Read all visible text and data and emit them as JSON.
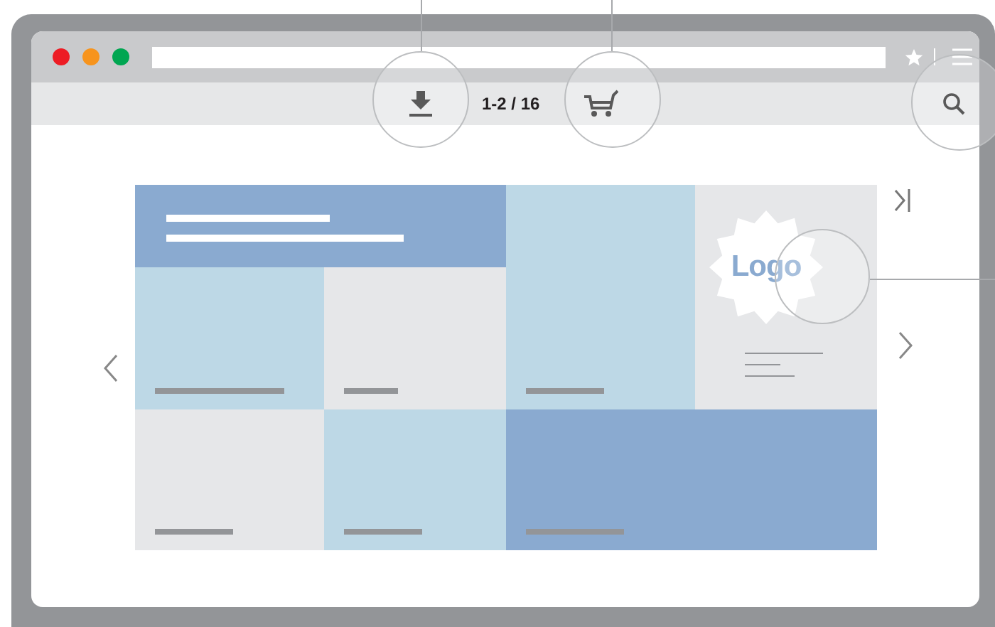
{
  "browser": {
    "window_controls": [
      {
        "color": "#ed1c24"
      },
      {
        "color": "#f7941d"
      },
      {
        "color": "#00a651"
      }
    ]
  },
  "toolbar": {
    "page_count": "1-2 / 16"
  },
  "tiles": [
    {
      "kind": "header",
      "color": "#8aaad0"
    },
    {
      "kind": "card",
      "color": "#bdd8e6"
    },
    {
      "kind": "logo",
      "color": "#e6e7e9",
      "logo_text": "Logo"
    },
    {
      "kind": "card",
      "color": "#bdd8e6"
    },
    {
      "kind": "card",
      "color": "#e6e7e9"
    },
    {
      "kind": "card",
      "color": "#e6e7e9"
    },
    {
      "kind": "card",
      "color": "#bdd8e6"
    },
    {
      "kind": "card",
      "color": "#8aaad0"
    }
  ]
}
